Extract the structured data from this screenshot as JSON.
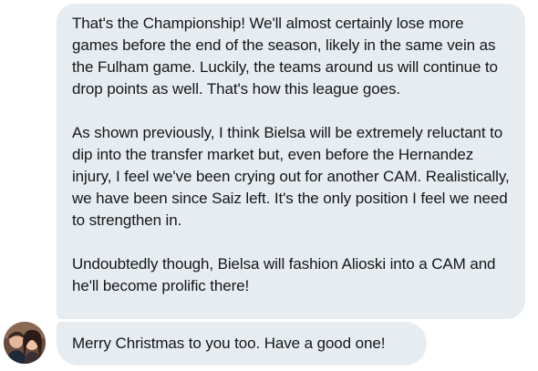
{
  "messages": [
    {
      "paragraphs": [
        "That's the Championship! We'll almost certainly lose more games before the end of the season, likely in the same vein as the Fulham game. Luckily, the teams around us will continue to drop points as well. That's how this league goes.",
        "As shown previously, I think Bielsa will be extremely reluctant to dip into the transfer market but, even before the Hernandez injury, I feel we've been crying out for another CAM. Realistically, we have been since Saiz left. It's the only position I feel we need to strengthen in.",
        "Undoubtedly though, Bielsa will fashion Alioski into a CAM and he'll become prolific there!"
      ]
    },
    {
      "text": "Merry Christmas to you too. Have a good one!",
      "avatar_icon": "user-avatar-photo"
    }
  ],
  "colors": {
    "bubble_background": "#e6ecf0",
    "text": "#14171a"
  }
}
